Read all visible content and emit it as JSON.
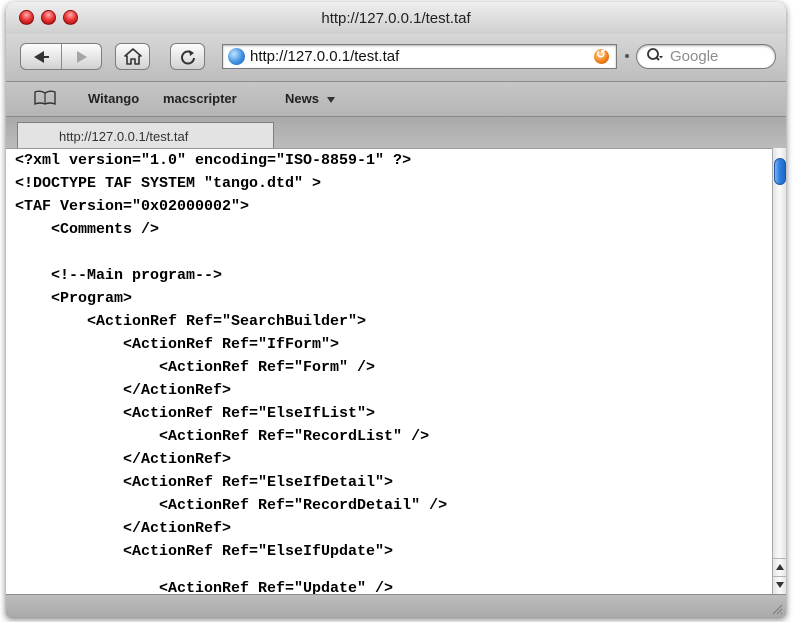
{
  "window": {
    "title": "http://127.0.0.1/test.taf"
  },
  "toolbar": {
    "address_url": "http://127.0.0.1/test.taf",
    "search_placeholder": "Google"
  },
  "bookmarks": {
    "items": [
      "Witango",
      "macscripter",
      "News"
    ]
  },
  "tabs": [
    {
      "label": "http://127.0.0.1/test.taf"
    }
  ],
  "content": {
    "lines": [
      "<?xml version=\"1.0\" encoding=\"ISO-8859-1\" ?>",
      "<!DOCTYPE TAF SYSTEM \"tango.dtd\" >",
      "<TAF Version=\"0x02000002\">",
      "    <Comments />",
      "",
      "    <!--Main program-->",
      "    <Program>",
      "        <ActionRef Ref=\"SearchBuilder\">",
      "            <ActionRef Ref=\"IfForm\">",
      "                <ActionRef Ref=\"Form\" />",
      "            </ActionRef>",
      "            <ActionRef Ref=\"ElseIfList\">",
      "                <ActionRef Ref=\"RecordList\" />",
      "            </ActionRef>",
      "            <ActionRef Ref=\"ElseIfDetail\">",
      "                <ActionRef Ref=\"RecordDetail\" />",
      "            </ActionRef>",
      "            <ActionRef Ref=\"ElseIfUpdate\">",
      "                <ActionRef Ref=\"Update\" />"
    ]
  },
  "colors": {
    "scroll_thumb": "#2f7fde",
    "traffic_light": "#ee3a3a"
  }
}
